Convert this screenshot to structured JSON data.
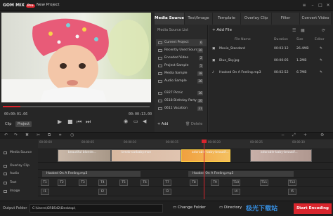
{
  "titlebar": {
    "logo": "GOM MIX",
    "pro_badge": "Pro",
    "project_title": "New Project",
    "menu_icon": "menu-icon",
    "minimize_icon": "minimize-icon",
    "maximize_icon": "maximize-icon",
    "close_icon": "close-icon"
  },
  "player": {
    "current_time": "00:00:01.66",
    "total_time": "00:00:13.00",
    "progress": 0.12,
    "tabs": [
      "Clip",
      "Project"
    ],
    "active_tab": "Project"
  },
  "panel": {
    "tabs": [
      "Media Source",
      "Text/Image",
      "Template",
      "Overlay Clip",
      "Filter",
      "Convert Video"
    ],
    "active_tab": "Media Source",
    "source_list_header": "Media Source List",
    "sources": [
      {
        "label": "Current Project",
        "count": "6"
      },
      {
        "label": "Recently Used Source",
        "count": "10"
      },
      {
        "label": "Encoded Video",
        "count": "2"
      },
      {
        "label": "Project Sample",
        "count": "5"
      },
      {
        "label": "Media Sample",
        "count": "18"
      },
      {
        "label": "Audio Sample",
        "count": "36"
      },
      {
        "label": "0327 Picnic",
        "count": "16"
      },
      {
        "label": "0518 Birthday Party",
        "count": "20"
      },
      {
        "label": "0611 Vacation",
        "count": "21"
      }
    ],
    "add_file": "Add File",
    "add_label": "Add",
    "delete_label": "Delete",
    "columns": [
      "File Name",
      "Duration",
      "Size",
      "Editor"
    ],
    "files": [
      {
        "name": "Movie_Standard",
        "duration": "00:03:12",
        "size": "26.4MB"
      },
      {
        "name": "Blue_Sky.jpg",
        "duration": "00:00:05",
        "size": "1.2MB"
      },
      {
        "name": "Hooked On A Feeling.mp3",
        "duration": "00:02:52",
        "size": "6.7MB"
      }
    ]
  },
  "timeline": {
    "ruler": [
      "00:00:00",
      "00:00:05",
      "00:00:10",
      "00:00:15",
      "00:00:20",
      "00:00:25",
      "00:00:30"
    ],
    "tracks": [
      "Media Source",
      "Overlay Clip",
      "Audio",
      "Text",
      "Image"
    ],
    "clips": [
      "beautiful blonde...",
      "break-carbaby.mov",
      "adorable-baby-beautif...",
      "adorable-baby-beautif..."
    ],
    "audio_clips": [
      "Hooked On A Feeling.mp3",
      "Hooked On A Feeling.mp3"
    ],
    "text_items": [
      "T1",
      "T2",
      "T3",
      "T4",
      "T5",
      "T6",
      "T7",
      "T8",
      "T9",
      "T10",
      "T11",
      "T12"
    ],
    "image_items": [
      "I1",
      "I2",
      "I3",
      "I4",
      "I5"
    ],
    "colors": {
      "playhead": "#d9252d",
      "accent": "#d9252d"
    }
  },
  "bottom": {
    "output_folder_label": "Output Folder",
    "output_path": "C:\\Users\\GRBS42\\Desktop\\",
    "change_folder": "Change Folder",
    "directory": "Directory",
    "start_encoding": "Start Encoding",
    "watermark": "极光下载站"
  }
}
